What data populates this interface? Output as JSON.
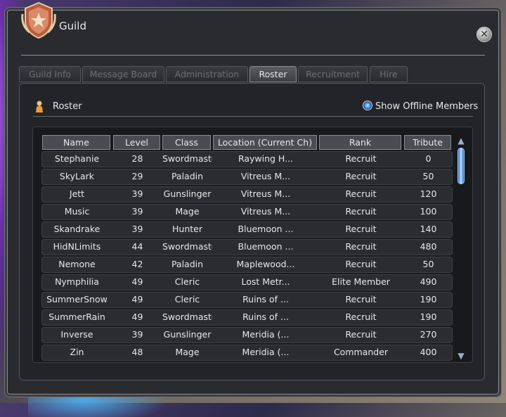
{
  "window": {
    "title": "Guild"
  },
  "tabs": [
    {
      "label": "Guild Info",
      "active": false
    },
    {
      "label": "Message Board",
      "active": false
    },
    {
      "label": "Administration",
      "active": false
    },
    {
      "label": "Roster",
      "active": true
    },
    {
      "label": "Recruitment",
      "active": false
    },
    {
      "label": "Hire",
      "active": false
    }
  ],
  "roster": {
    "label": "Roster",
    "offline_toggle": {
      "label": "Show Offline Members",
      "checked": true
    },
    "columns": [
      "Name",
      "Level",
      "Class",
      "Location (Current Ch)",
      "Rank",
      "Tribute"
    ],
    "rows": [
      [
        "Stephanie",
        "28",
        "Swordmaster",
        "Raywing H...",
        "Recruit",
        "0"
      ],
      [
        "SkyLark",
        "29",
        "Paladin",
        "Vitreus M...",
        "Recruit",
        "50"
      ],
      [
        "Jett",
        "39",
        "Gunslinger",
        "Vitreus M...",
        "Recruit",
        "120"
      ],
      [
        "Music",
        "39",
        "Mage",
        "Vitreus M...",
        "Recruit",
        "100"
      ],
      [
        "Skandrake",
        "39",
        "Hunter",
        "Bluemoon ...",
        "Recruit",
        "140"
      ],
      [
        "HidNLimits",
        "44",
        "Swordmaster",
        "Bluemoon ...",
        "Recruit",
        "480"
      ],
      [
        "Nemone",
        "42",
        "Paladin",
        "Maplewood...",
        "Recruit",
        "50"
      ],
      [
        "Nymphilia",
        "49",
        "Cleric",
        "Lost Metr...",
        "Elite Member",
        "490"
      ],
      [
        "SummerSnow",
        "49",
        "Cleric",
        "Ruins of ...",
        "Recruit",
        "190"
      ],
      [
        "SummerRain",
        "49",
        "Swordmaster",
        "Ruins of ...",
        "Recruit",
        "190"
      ],
      [
        "Inverse",
        "39",
        "Gunslinger",
        "Meridia (...",
        "Recruit",
        "270"
      ],
      [
        "Zin",
        "48",
        "Mage",
        "Meridia (...",
        "Commander",
        "400"
      ]
    ]
  },
  "icons": {
    "emblem": "guild-emblem-icon",
    "close": "close-icon",
    "roster": "person-icon",
    "scroll_up": "scroll-up-arrow-icon",
    "scroll_down": "scroll-down-arrow-icon"
  },
  "colors": {
    "text": "#e8e8e8",
    "accent": "#4a8ad6",
    "inactive_tab": "#6e7074"
  }
}
